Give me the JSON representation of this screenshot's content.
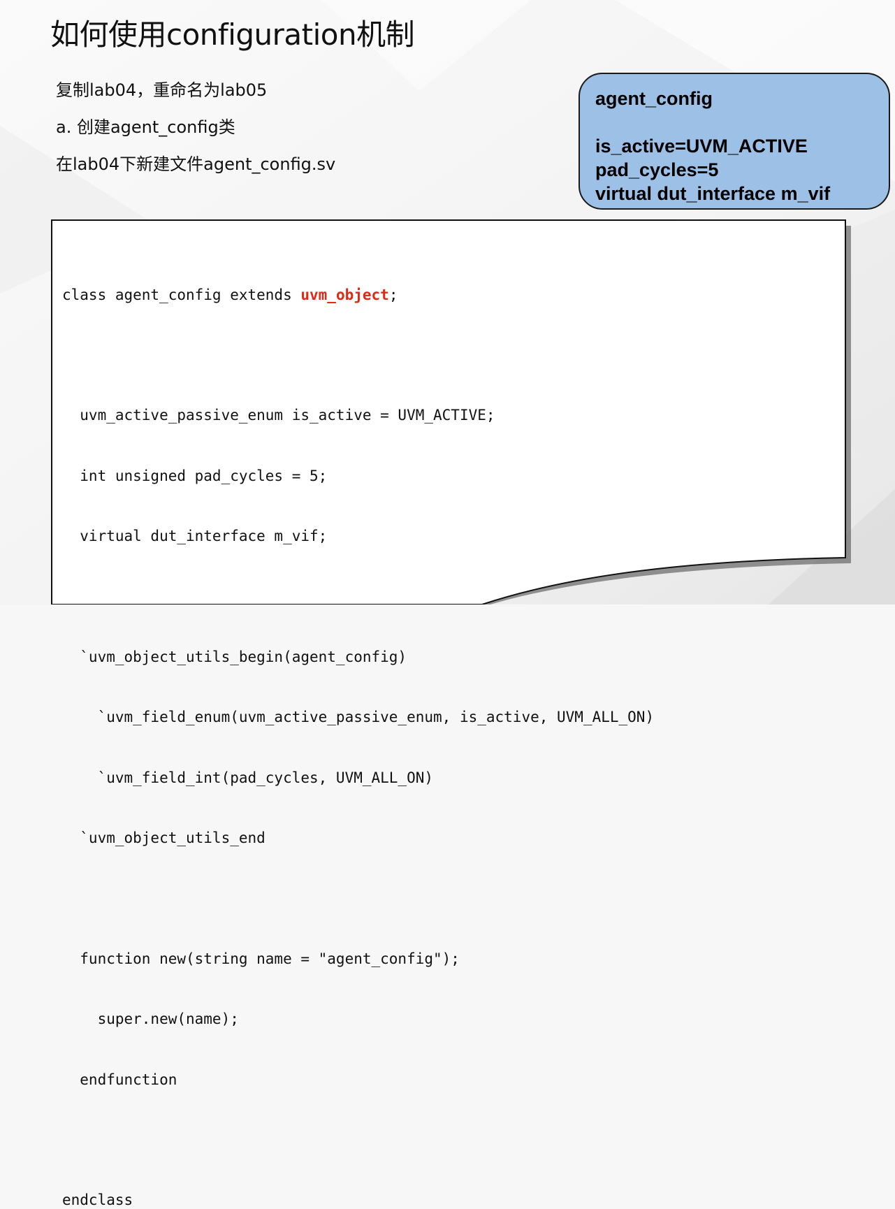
{
  "slide": {
    "title": "如何使用configuration机制",
    "bullets": [
      "复制lab04，重命名为lab05",
      "a. 创建agent_config类",
      "在lab04下新建文件agent_config.sv"
    ]
  },
  "callout": {
    "title": "agent_config",
    "lines": [
      "is_active=UVM_ACTIVE",
      "pad_cycles=5",
      "virtual dut_interface m_vif"
    ],
    "fill_color": "#9cc0e6"
  },
  "code": {
    "line1_before": "class agent_config extends ",
    "line1_highlight": "uvm_object",
    "line1_after": ";",
    "highlight_color": "#e02a16",
    "lines": [
      "",
      "  uvm_active_passive_enum is_active = UVM_ACTIVE;",
      "  int unsigned pad_cycles = 5;",
      "  virtual dut_interface m_vif;",
      "",
      "  `uvm_object_utils_begin(agent_config)",
      "    `uvm_field_enum(uvm_active_passive_enum, is_active, UVM_ALL_ON)",
      "    `uvm_field_int(pad_cycles, UVM_ALL_ON)",
      "  `uvm_object_utils_end",
      "",
      "  function new(string name = \"agent_config\");",
      "    super.new(name);",
      "  endfunction",
      "",
      "endclass"
    ]
  }
}
